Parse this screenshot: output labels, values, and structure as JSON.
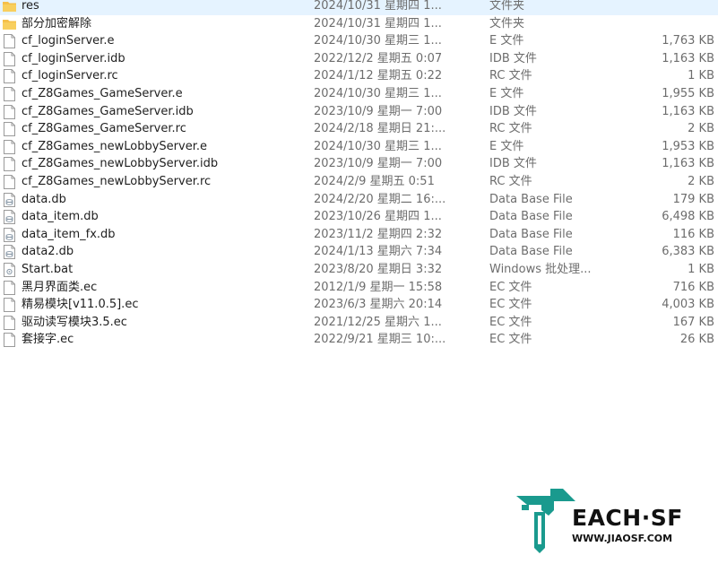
{
  "files": [
    {
      "name": "res",
      "date": "2024/10/31 星期四 1...",
      "type": "文件夹",
      "size": "",
      "icon": "folder-icon"
    },
    {
      "name": "部分加密解除",
      "date": "2024/10/31 星期四 1...",
      "type": "文件夹",
      "size": "",
      "icon": "folder-icon"
    },
    {
      "name": "cf_loginServer.e",
      "date": "2024/10/30 星期三 1...",
      "type": "E 文件",
      "size": "1,763 KB",
      "icon": "file-icon"
    },
    {
      "name": "cf_loginServer.idb",
      "date": "2022/12/2 星期五 0:07",
      "type": "IDB 文件",
      "size": "1,163 KB",
      "icon": "file-icon"
    },
    {
      "name": "cf_loginServer.rc",
      "date": "2024/1/12 星期五 0:22",
      "type": "RC 文件",
      "size": "1 KB",
      "icon": "file-icon"
    },
    {
      "name": "cf_Z8Games_GameServer.e",
      "date": "2024/10/30 星期三 1...",
      "type": "E 文件",
      "size": "1,955 KB",
      "icon": "file-icon"
    },
    {
      "name": "cf_Z8Games_GameServer.idb",
      "date": "2023/10/9 星期一 7:00",
      "type": "IDB 文件",
      "size": "1,163 KB",
      "icon": "file-icon"
    },
    {
      "name": "cf_Z8Games_GameServer.rc",
      "date": "2024/2/18 星期日 21:...",
      "type": "RC 文件",
      "size": "2 KB",
      "icon": "file-icon"
    },
    {
      "name": "cf_Z8Games_newLobbyServer.e",
      "date": "2024/10/30 星期三 1...",
      "type": "E 文件",
      "size": "1,953 KB",
      "icon": "file-icon"
    },
    {
      "name": "cf_Z8Games_newLobbyServer.idb",
      "date": "2023/10/9 星期一 7:00",
      "type": "IDB 文件",
      "size": "1,163 KB",
      "icon": "file-icon"
    },
    {
      "name": "cf_Z8Games_newLobbyServer.rc",
      "date": "2024/2/9 星期五 0:51",
      "type": "RC 文件",
      "size": "2 KB",
      "icon": "file-icon"
    },
    {
      "name": "data.db",
      "date": "2024/2/20 星期二 16:...",
      "type": "Data Base File",
      "size": "179 KB",
      "icon": "database-file-icon"
    },
    {
      "name": "data_item.db",
      "date": "2023/10/26 星期四 1...",
      "type": "Data Base File",
      "size": "6,498 KB",
      "icon": "database-file-icon"
    },
    {
      "name": "data_item_fx.db",
      "date": "2023/11/2 星期四 2:32",
      "type": "Data Base File",
      "size": "116 KB",
      "icon": "database-file-icon"
    },
    {
      "name": "data2.db",
      "date": "2024/1/13 星期六 7:34",
      "type": "Data Base File",
      "size": "6,383 KB",
      "icon": "database-file-icon"
    },
    {
      "name": "Start.bat",
      "date": "2023/8/20 星期日 3:32",
      "type": "Windows 批处理...",
      "size": "1 KB",
      "icon": "batch-file-icon"
    },
    {
      "name": "黑月界面类.ec",
      "date": "2012/1/9 星期一 15:58",
      "type": "EC 文件",
      "size": "716 KB",
      "icon": "file-icon"
    },
    {
      "name": "精易模块[v11.0.5].ec",
      "date": "2023/6/3 星期六 20:14",
      "type": "EC 文件",
      "size": "4,003 KB",
      "icon": "file-icon"
    },
    {
      "name": "驱动读写模块3.5.ec",
      "date": "2021/12/25 星期六 1...",
      "type": "EC 文件",
      "size": "167 KB",
      "icon": "file-icon"
    },
    {
      "name": "套接字.ec",
      "date": "2022/9/21 星期三 10:...",
      "type": "EC 文件",
      "size": "26 KB",
      "icon": "file-icon"
    }
  ],
  "watermark": {
    "logo_text": "EACH·SF",
    "url": "WWW.JIAOSF.COM",
    "logo_color": "#1a9a8e"
  },
  "colors": {
    "folder": "#f5c04a",
    "text_primary": "#1f1f1f",
    "text_secondary": "#6d6d6d"
  }
}
